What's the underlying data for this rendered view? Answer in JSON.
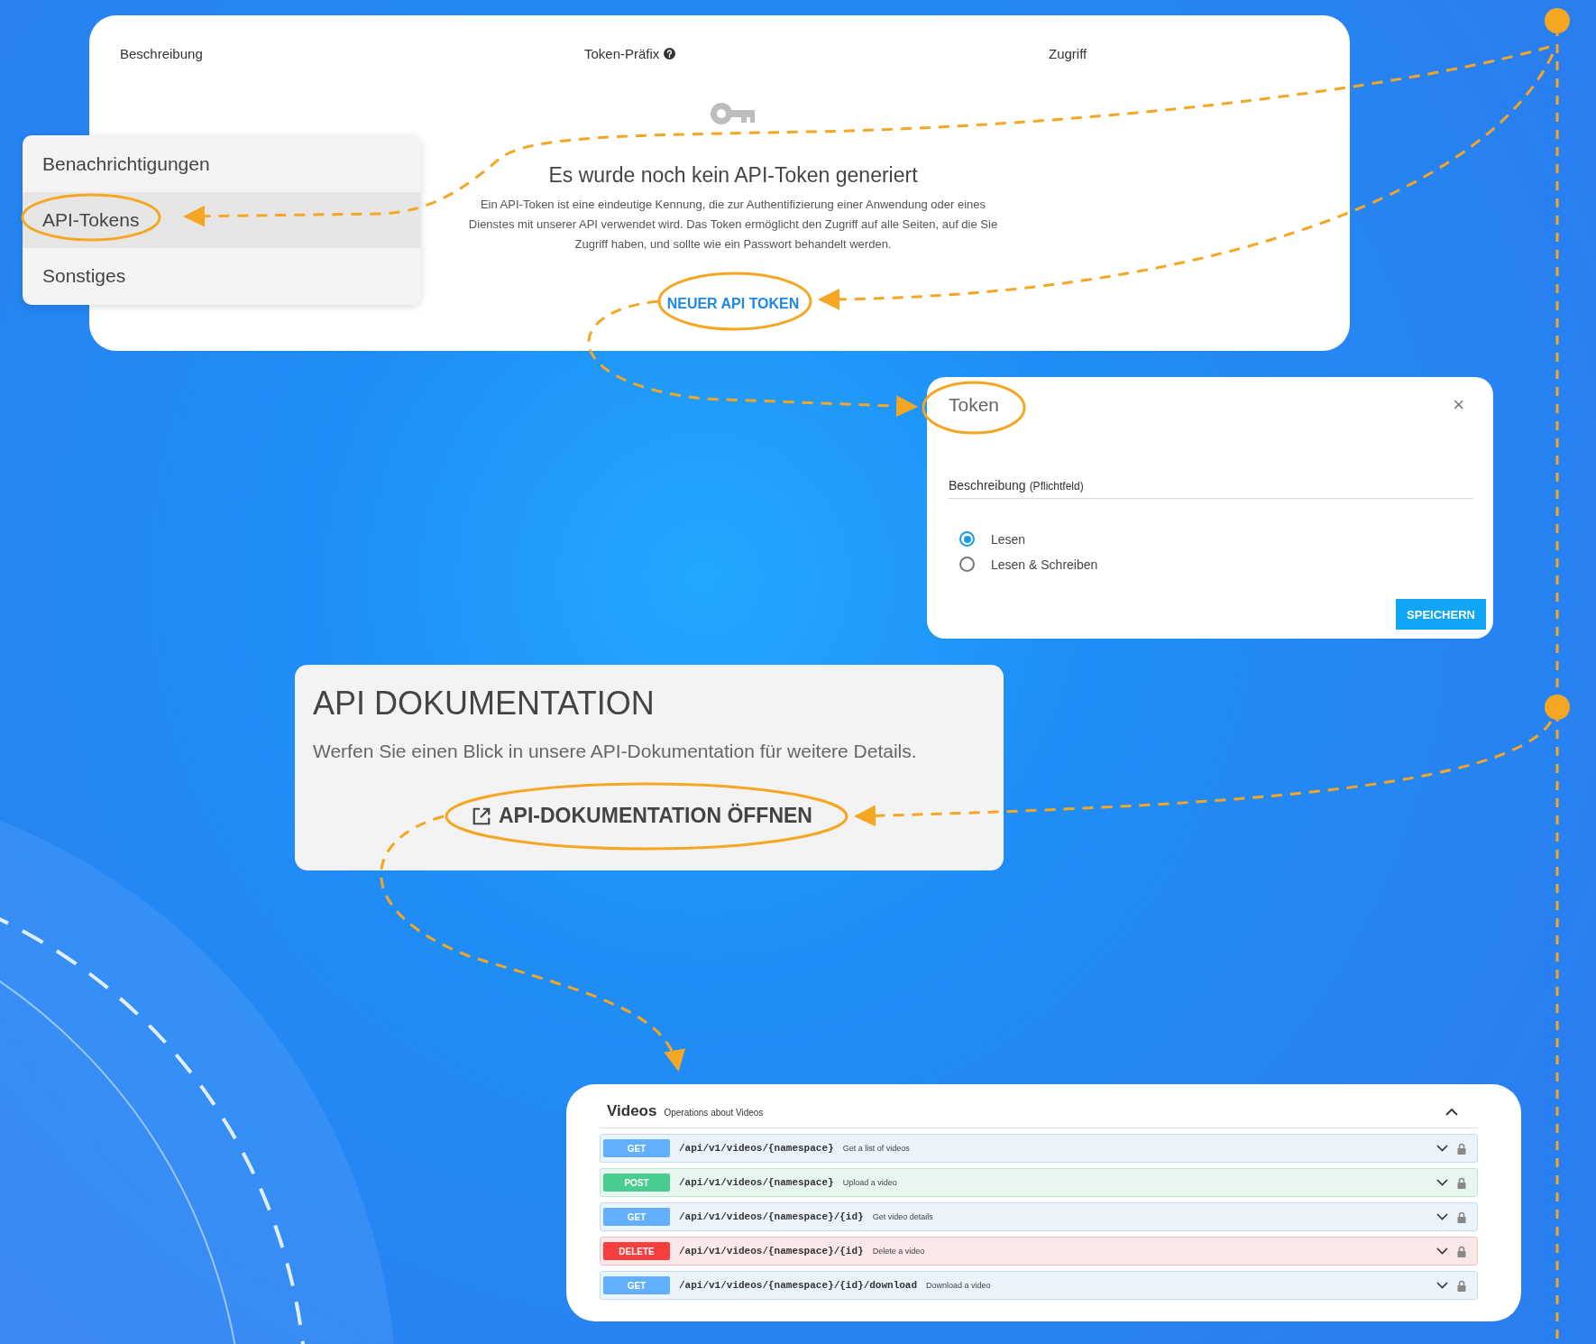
{
  "token_table": {
    "columns": [
      "Beschreibung",
      "Token-Präfix",
      "Zugriff"
    ],
    "empty_title": "Es wurde noch kein API-Token generiert",
    "empty_text": "Ein API-Token ist eine eindeutige Kennung, die zur Authentifizierung einer Anwendung oder eines Dienstes mit unserer API verwendet wird. Das Token ermöglicht den Zugriff auf alle Seiten, auf die Sie Zugriff haben, und sollte wie ein Passwort behandelt werden.",
    "new_token_button": "NEUER API TOKEN"
  },
  "sidebar": {
    "items": [
      {
        "label": "Benachrichtigungen",
        "selected": false
      },
      {
        "label": "API-Tokens",
        "selected": true
      },
      {
        "label": "Sonstiges",
        "selected": false
      }
    ]
  },
  "token_dialog": {
    "title": "Token",
    "close": "×",
    "field": {
      "label": "Beschreibung",
      "note": "(Pflichtfeld)"
    },
    "options": [
      {
        "label": "Lesen",
        "selected": true
      },
      {
        "label": "Lesen & Schreiben",
        "selected": false
      }
    ],
    "save_button": "SPEICHERN"
  },
  "api_docs": {
    "title": "API DOKUMENTATION",
    "text": "Werfen Sie einen Blick in unsere API-Dokumentation für weitere Details.",
    "button": "API-DOKUMENTATION ÖFFNEN"
  },
  "videos": {
    "title": "Videos",
    "subtitle": "Operations about Videos",
    "endpoints": [
      {
        "kind": "get",
        "method": "GET",
        "path": "/api/v1/videos/{namespace}",
        "summary": "Get a list of videos"
      },
      {
        "kind": "post",
        "method": "POST",
        "path": "/api/v1/videos/{namespace}",
        "summary": "Upload a video"
      },
      {
        "kind": "get",
        "method": "GET",
        "path": "/api/v1/videos/{namespace}/{id}",
        "summary": "Get video details"
      },
      {
        "kind": "delete",
        "method": "DELETE",
        "path": "/api/v1/videos/{namespace}/{id}",
        "summary": "Delete a video"
      },
      {
        "kind": "get",
        "method": "GET",
        "path": "/api/v1/videos/{namespace}/{id}/download",
        "summary": "Download a video"
      }
    ]
  }
}
